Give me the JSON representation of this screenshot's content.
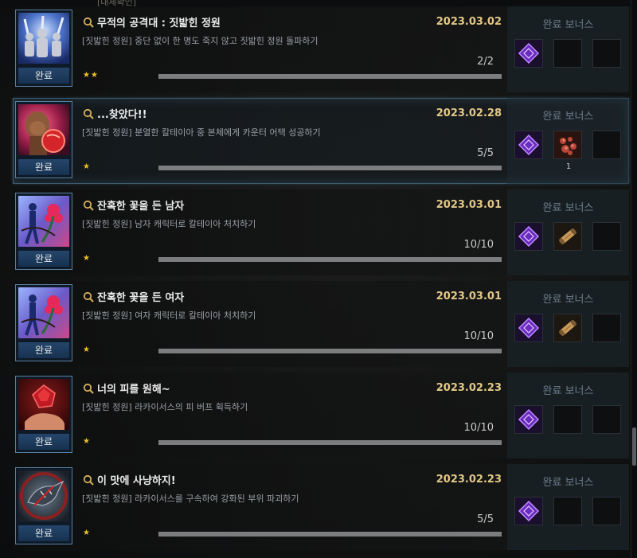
{
  "top_peek": "[대체확인]",
  "bonus_title": "완료 보너스",
  "done_label": "완료",
  "achievements": [
    {
      "title": "무적의 공격대 : 짓밟힌 정원",
      "date": "2023.03.02",
      "desc": "[짓밟힌 정원] 중단 없이 한 명도 죽지 않고 짓밟힌 정원 돌파하기",
      "count": "2/2",
      "stars": "★★",
      "icon": "raid-group-icon",
      "rewards": [
        "purple-crystal-icon"
      ],
      "reward_qty": [
        ""
      ]
    },
    {
      "title": "...찾았다!!",
      "date": "2023.02.28",
      "desc": "[짓밟힌 정원] 분열한 칼테이아 중 본체에게 카운터 어택 성공하기",
      "count": "5/5",
      "stars": "★",
      "icon": "punch-icon",
      "rewards": [
        "purple-crystal-icon",
        "red-cluster-icon"
      ],
      "reward_qty": [
        "",
        "1"
      ]
    },
    {
      "title": "잔혹한 꽃을 든 남자",
      "date": "2023.03.01",
      "desc": "[짓밟힌 정원] 남자 캐릭터로 칼테이아 처치하기",
      "count": "10/10",
      "stars": "★",
      "icon": "flower-man-icon",
      "rewards": [
        "purple-crystal-icon",
        "scroll-icon"
      ],
      "reward_qty": [
        "",
        ""
      ]
    },
    {
      "title": "잔혹한 꽃을 든 여자",
      "date": "2023.03.01",
      "desc": "[짓밟힌 정원] 여자 캐릭터로 칼테이아 처치하기",
      "count": "10/10",
      "stars": "★",
      "icon": "flower-woman-icon",
      "rewards": [
        "purple-crystal-icon",
        "scroll-icon"
      ],
      "reward_qty": [
        "",
        ""
      ]
    },
    {
      "title": "너의 피를 원해~",
      "date": "2023.02.23",
      "desc": "[짓밟힌 정원] 라카이서스의 피 버프 획득하기",
      "count": "10/10",
      "stars": "★",
      "icon": "blood-gem-icon",
      "rewards": [
        "purple-crystal-icon"
      ],
      "reward_qty": [
        ""
      ]
    },
    {
      "title": "이 맛에 사냥하지!",
      "date": "2023.02.23",
      "desc": "[짓밟힌 정원] 라카이서스를 구속하여 강화된 부위 파괴하기",
      "count": "5/5",
      "stars": "★",
      "icon": "dragon-icon",
      "rewards": [
        "purple-crystal-icon"
      ],
      "reward_qty": [
        ""
      ]
    }
  ],
  "colors": {
    "date": "#e2c888",
    "star": "#f0c020",
    "selected_border": "#3f5c6c",
    "done_label_bg": "#24466a"
  }
}
